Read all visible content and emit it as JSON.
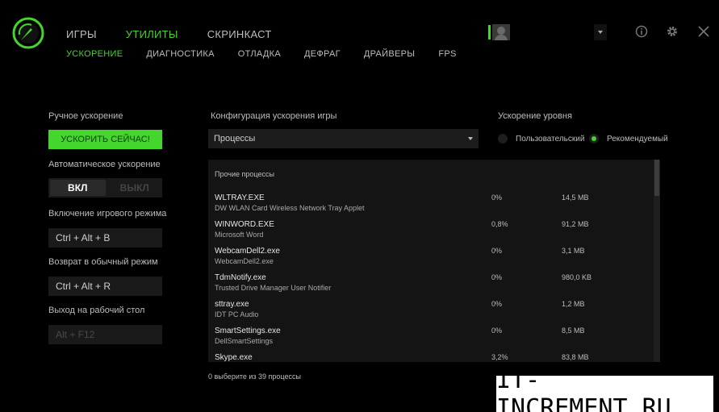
{
  "nav": {
    "top": [
      {
        "label": "ИГРЫ",
        "active": false
      },
      {
        "label": "УТИЛИТЫ",
        "active": true
      },
      {
        "label": "СКРИНКАСТ",
        "active": false
      }
    ],
    "sub": [
      {
        "label": "УСКОРЕНИЕ",
        "active": true
      },
      {
        "label": "ДИАГНОСТИКА",
        "active": false
      },
      {
        "label": "ОТЛАДКА",
        "active": false
      },
      {
        "label": "ДЕФРАГ",
        "active": false
      },
      {
        "label": "ДРАЙВЕРЫ",
        "active": false
      },
      {
        "label": "FPS",
        "active": false
      }
    ]
  },
  "header_icons": {
    "info": "info-icon",
    "settings": "gear-icon",
    "close": "close-icon"
  },
  "left": {
    "manual_label": "Ручное ускорение",
    "boost_button": "УСКОРИТЬ СЕЙЧАС!",
    "auto_label": "Автоматическое ускорение",
    "toggle_on": "ВКЛ",
    "toggle_off": "ВЫКЛ",
    "game_mode_label": "Включение игрового режима",
    "game_mode_hotkey": "Ctrl + Alt + B",
    "normal_mode_label": "Возврат в обычный режим",
    "normal_mode_hotkey": "Ctrl + Alt + R",
    "desktop_label": "Выход на рабочий стол",
    "desktop_hotkey": "Alt + F12"
  },
  "config": {
    "label": "Конфигурация ускорения игры",
    "select_value": "Процессы"
  },
  "level": {
    "label": "Ускорение уровня",
    "option_custom": "Пользовательский",
    "option_recommended": "Рекомендуемый",
    "selected": "recommended"
  },
  "processes": {
    "group": "Прочие процессы",
    "rows": [
      {
        "name": "WLTRAY.EXE",
        "desc": "DW WLAN Card Wireless Network Tray Applet",
        "cpu": "0%",
        "mem": "14,5 MB"
      },
      {
        "name": "WINWORD.EXE",
        "desc": "Microsoft Word",
        "cpu": "0,8%",
        "mem": "91,2 MB"
      },
      {
        "name": "WebcamDell2.exe",
        "desc": "WebcamDell2.exe",
        "cpu": "0%",
        "mem": "3,1 MB"
      },
      {
        "name": "TdmNotify.exe",
        "desc": "Trusted Drive Manager User Notifier",
        "cpu": "0%",
        "mem": "980,0 KB"
      },
      {
        "name": "sttray.exe",
        "desc": "IDT PC Audio",
        "cpu": "0%",
        "mem": "1,2 MB"
      },
      {
        "name": "SmartSettings.exe",
        "desc": "DellSmartSettings",
        "cpu": "0%",
        "mem": "8,5 MB"
      },
      {
        "name": "Skype.exe",
        "desc": "",
        "cpu": "3,2%",
        "mem": "83,8 MB"
      }
    ],
    "footer": "0 выберите из 39 процессы"
  },
  "watermark": "IT-INCREMENT.RU",
  "colors": {
    "accent": "#44d62c",
    "background": "#000000",
    "panel": "#141414"
  }
}
